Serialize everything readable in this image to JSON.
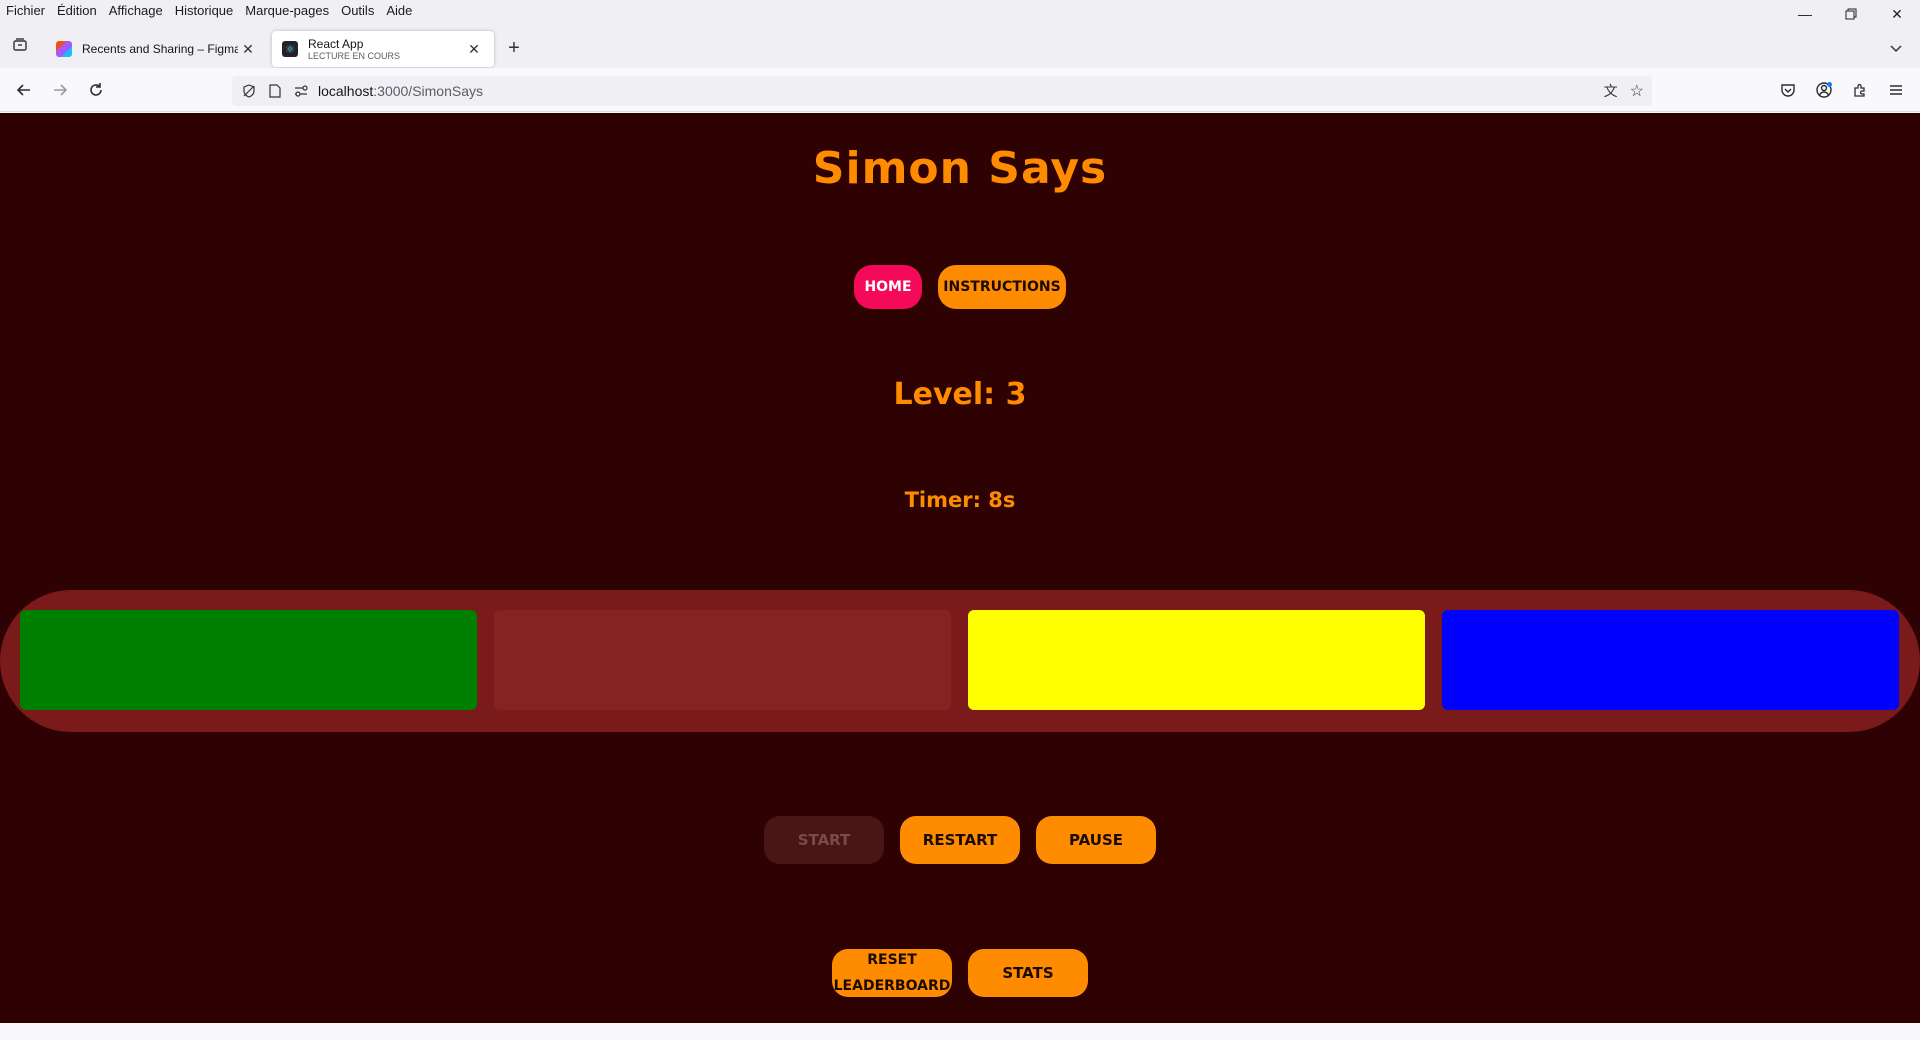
{
  "browser": {
    "menu": [
      "Fichier",
      "Édition",
      "Affichage",
      "Historique",
      "Marque-pages",
      "Outils",
      "Aide"
    ],
    "tabs": [
      {
        "title": "Recents and Sharing – Figma",
        "subtitle": ""
      },
      {
        "title": "React App",
        "subtitle": "LECTURE EN COURS"
      }
    ],
    "url": {
      "host": "localhost",
      "path": ":3000/SimonSays"
    }
  },
  "page": {
    "title": "Simon Says",
    "nav": {
      "home": "HOME",
      "instructions": "INSTRUCTIONS"
    },
    "level": "Level: 3",
    "timer": "Timer: 8s",
    "pads": [
      "green",
      "red",
      "yellow",
      "blue"
    ],
    "controls": {
      "start": "START",
      "restart": "RESTART",
      "pause": "PAUSE"
    },
    "bottom": {
      "reset": "RESET LEADERBOARD",
      "stats": "STATS"
    }
  },
  "colors": {
    "background": "#2e0102",
    "accent": "#ff8c00",
    "home": "#f50a5a",
    "board": "#7b1a1a",
    "pad_green": "#008000",
    "pad_red_dim": "#852321",
    "pad_yellow": "#ffff00",
    "pad_blue": "#0000ff"
  }
}
